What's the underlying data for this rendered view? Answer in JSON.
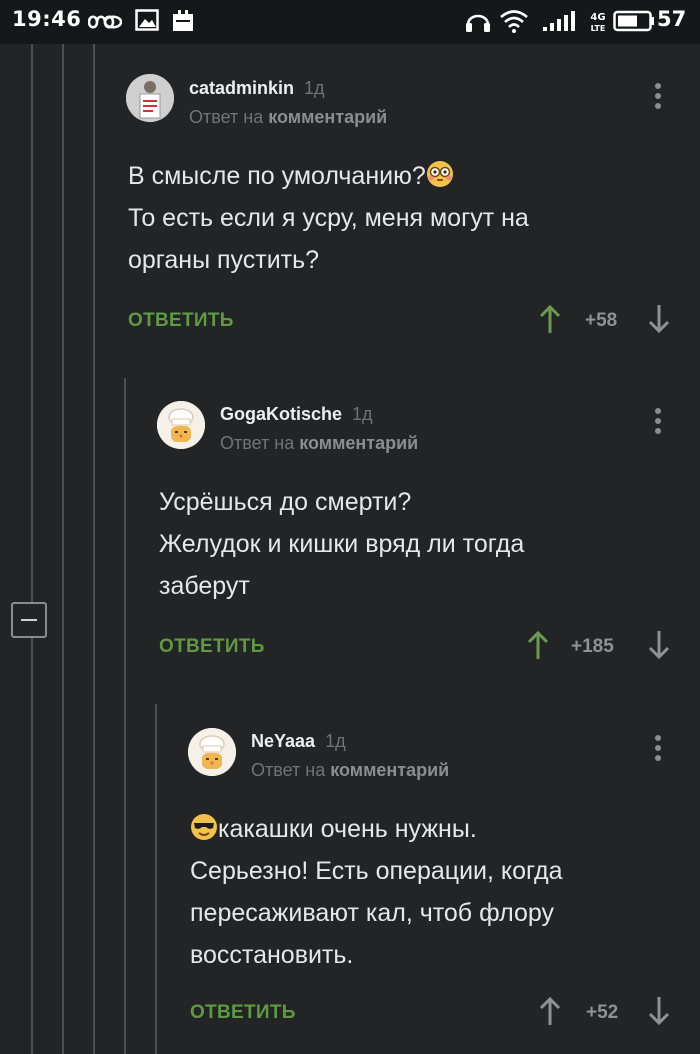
{
  "status_bar": {
    "time": "19:46",
    "battery": "57",
    "network": "4G LTE"
  },
  "comments": [
    {
      "username": "catadminkin",
      "age": "1д",
      "reply_prefix": "Ответ на",
      "reply_target": "комментарий",
      "lines": [
        "В смысле по умолчанию?",
        "То есть если я усру, меня могут на",
        "органы пустить?"
      ],
      "emoji_after_line1": "flushed-face",
      "reply_label": "ОТВЕТИТЬ",
      "rating": "+58"
    },
    {
      "username": "GogaKotische",
      "age": "1д",
      "reply_prefix": "Ответ на",
      "reply_target": "комментарий",
      "lines": [
        "Усрёшься до смерти?",
        "Желудок и кишки вряд ли тогда",
        "заберут"
      ],
      "reply_label": "ОТВЕТИТЬ",
      "rating": "+185"
    },
    {
      "username": "NeYaaa",
      "age": "1д",
      "reply_prefix": "Ответ на",
      "reply_target": "комментарий",
      "lines": [
        "какашки очень нужны.",
        "Серьезно! Есть операции, когда",
        "пересаживают кал, чтоб флору",
        "восстановить."
      ],
      "emoji_before_line1": "sunglasses-face",
      "reply_label": "ОТВЕТИТЬ",
      "rating": "+52"
    }
  ],
  "colors": {
    "background": "#222426",
    "reply_green": "#5f9a43",
    "upvote_green": "#6a9b4f",
    "muted": "#707477"
  }
}
